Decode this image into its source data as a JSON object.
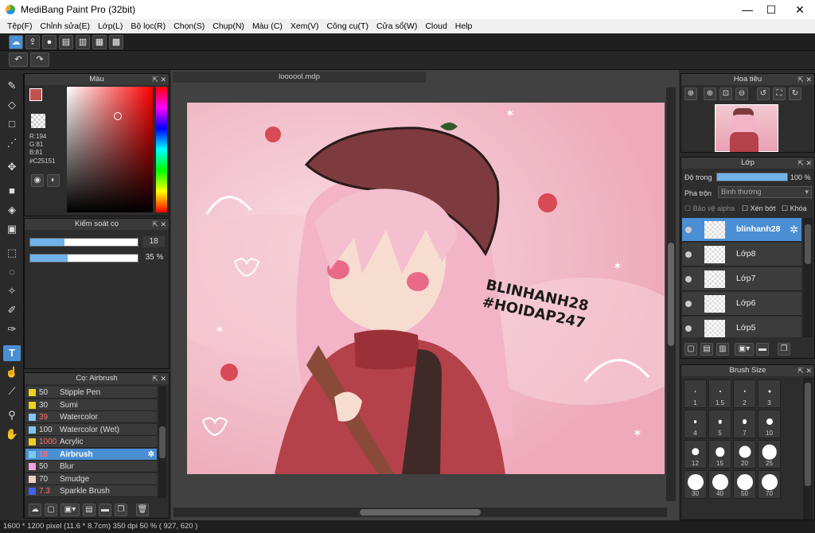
{
  "window": {
    "title": "MediBang Paint Pro (32bit)",
    "min": "—",
    "max": "☐",
    "close": "✕"
  },
  "menu": [
    "Tệp(F)",
    "Chỉnh sửa(E)",
    "Lớp(L)",
    "Bộ lọc(R)",
    "Chọn(S)",
    "Chụp(N)",
    "Màu (C)",
    "Xem(V)",
    "Công cụ(T)",
    "Cửa sổ(W)",
    "Cloud",
    "Help"
  ],
  "color_panel": {
    "title": "Màu",
    "r": "R:194",
    "g": "G:81",
    "b": "B:81",
    "hex": "#C25151",
    "fg": "#C25151"
  },
  "brush_control": {
    "title": "Kiểm soát cọ",
    "size": "18",
    "size_level": 0.32,
    "opacity": "35 %",
    "opacity_level": 0.35
  },
  "brush_list": {
    "title": "Cọ: Airbrush",
    "items": [
      {
        "num": "50",
        "name": "Stipple Pen",
        "color": "#f0d020"
      },
      {
        "num": "30",
        "name": "Sumi",
        "color": "#f0d020"
      },
      {
        "num": "39",
        "name": "Watercolor",
        "color": "#7ec8f0",
        "red": true
      },
      {
        "num": "100",
        "name": "Watercolor (Wet)",
        "color": "#7ec8f0"
      },
      {
        "num": "1000",
        "name": "Acrylic",
        "color": "#f0d020",
        "red": true
      },
      {
        "num": "18",
        "name": "Airbrush",
        "color": "#7ec8f0",
        "red": true,
        "selected": true
      },
      {
        "num": "50",
        "name": "Blur",
        "color": "#f0a0e0"
      },
      {
        "num": "70",
        "name": "Smudge",
        "color": "#f0d0c0"
      },
      {
        "num": "7.3",
        "name": "Sparkle Brush",
        "color": "#4060f0",
        "red": true
      }
    ]
  },
  "document": {
    "tab": "loooool.mdp"
  },
  "artwork": {
    "signature1": "BLINHANH28",
    "signature2": "#HOIDAP247"
  },
  "navigator": {
    "title": "Hoa tiêu"
  },
  "layers": {
    "title": "Lớp",
    "opacity_label": "Độ trong",
    "opacity_value": "100 %",
    "opacity_level": 1.0,
    "blend_label": "Pha trộn",
    "blend_value": "Bình thường",
    "protect_alpha": "Bảo vệ alpha",
    "clip": "Xén bớt",
    "lock": "Khóa",
    "items": [
      {
        "name": "blinhanh28",
        "selected": true
      },
      {
        "name": "Lớp8"
      },
      {
        "name": "Lớp7"
      },
      {
        "name": "Lớp6"
      },
      {
        "name": "Lớp5"
      }
    ]
  },
  "brush_size": {
    "title": "Brush Size",
    "sizes": [
      "1",
      "1.5",
      "2",
      "3",
      "4",
      "5",
      "7",
      "10",
      "12",
      "15",
      "20",
      "25",
      "30",
      "40",
      "50",
      "70"
    ]
  },
  "status": {
    "text": "1600 * 1200 pixel   (11.6 * 8.7cm)   350 dpi   50 %   ( 927, 620 )"
  }
}
